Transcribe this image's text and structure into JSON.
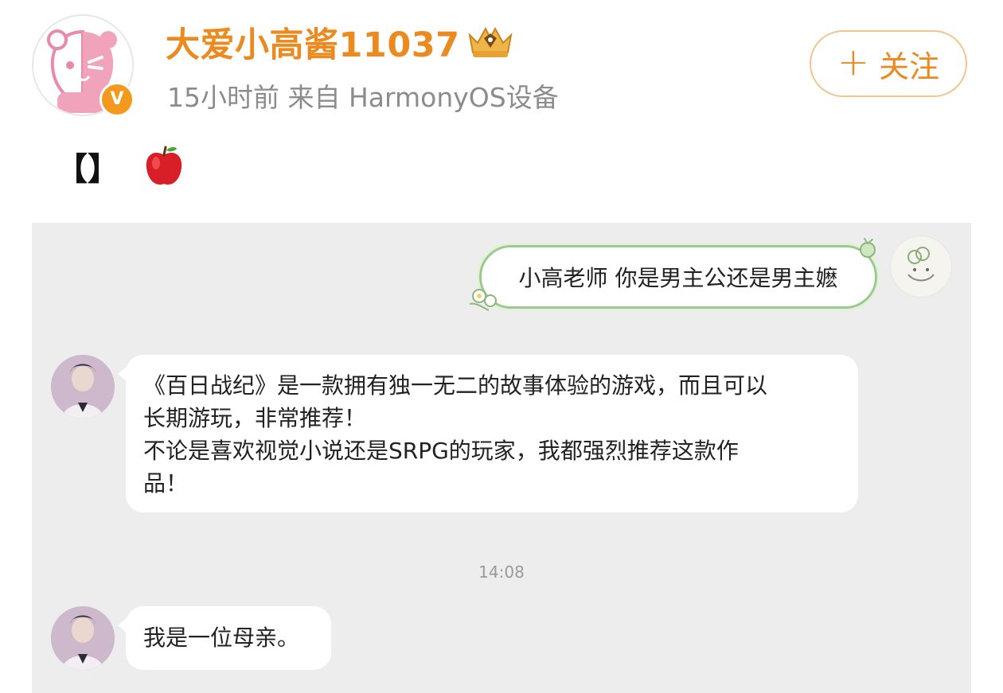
{
  "post": {
    "username": "大爱小高酱11037",
    "meta": "15小时前  来自 HarmonyOS设备",
    "follow_label": "关注",
    "follow_plus": "+",
    "verified_badge": "V",
    "text_brackets": "【】",
    "emoji_icon": "red-apple-icon"
  },
  "chat": {
    "outgoing_message": "小高老师 你是男主公还是男主嬷",
    "incoming_messages": [
      {
        "lines": [
          "《百日战纪》是一款拥有独一无二的故事体验的游戏，而且可以",
          "长期游玩，非常推荐！",
          "不论是喜欢视觉小说还是SRPG的玩家，我都强烈推荐这款作",
          "品！"
        ]
      },
      {
        "lines": [
          "我是一位母亲。"
        ]
      }
    ],
    "timestamp": "14:08"
  },
  "colors": {
    "username": "#eb8a1e",
    "follow_border": "#f2c48e",
    "verified": "#f39a1e",
    "chat_background": "#ededed",
    "outgoing_bubble_border": "#9cc98f"
  }
}
